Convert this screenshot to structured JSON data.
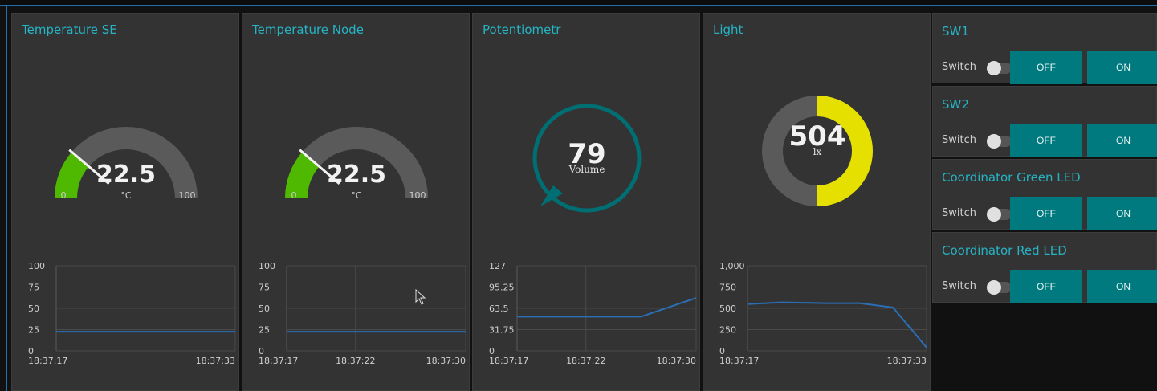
{
  "panels": [
    {
      "title": "Temperature SE",
      "gauge": {
        "value": "22.5",
        "unit": "°C",
        "min": "0",
        "max": "100",
        "fraction": 0.225,
        "fill_color": "#4fb800",
        "track_color": "#5a5a5a"
      },
      "chart_data": {
        "type": "line",
        "x": [
          "18:37:17",
          "18:37:33"
        ],
        "xticks": [
          "18:37:17",
          "18:37:33"
        ],
        "yticks": [
          "100",
          "75",
          "50",
          "25",
          "0"
        ],
        "ylim": [
          0,
          100
        ],
        "series": [
          {
            "values": [
              22.5,
              22.5
            ]
          }
        ],
        "grid": true
      }
    },
    {
      "title": "Temperature Node",
      "gauge": {
        "value": "22.5",
        "unit": "°C",
        "min": "0",
        "max": "100",
        "fraction": 0.225,
        "fill_color": "#4fb800",
        "track_color": "#5a5a5a"
      },
      "chart_data": {
        "type": "line",
        "x": [
          "18:37:17",
          "18:37:30"
        ],
        "xticks": [
          "18:37:17",
          "18:37:22",
          "18:37:30"
        ],
        "yticks": [
          "100",
          "75",
          "50",
          "25",
          "0"
        ],
        "ylim": [
          0,
          100
        ],
        "series": [
          {
            "values": [
              22.5,
              22.5
            ]
          }
        ],
        "grid": true
      }
    },
    {
      "title": "Potentiometr",
      "knob": {
        "value": "79",
        "label": "Volume",
        "color": "#006f73"
      },
      "chart_data": {
        "type": "line",
        "x": [
          "18:37:17",
          "18:37:20",
          "18:37:26",
          "18:37:30"
        ],
        "xticks": [
          "18:37:17",
          "18:37:22",
          "18:37:30"
        ],
        "yticks": [
          "127",
          "95.25",
          "63.5",
          "31.75",
          "0"
        ],
        "ylim": [
          0,
          127
        ],
        "series": [
          {
            "values": [
              51,
              51,
              51,
              79
            ]
          }
        ],
        "grid": true
      }
    },
    {
      "title": "Light",
      "donut": {
        "value": "504",
        "unit": "lx",
        "fraction": 0.5,
        "fill_color": "#e5e000",
        "track_color": "#5a5a5a"
      },
      "chart_data": {
        "type": "line",
        "x": [
          "18:37:17",
          "18:37:20",
          "18:37:24",
          "18:37:27",
          "18:37:30",
          "18:37:33"
        ],
        "xticks": [
          "18:37:17",
          "18:37:33"
        ],
        "yticks": [
          "1,000",
          "750",
          "500",
          "250",
          "0"
        ],
        "ylim": [
          0,
          1000
        ],
        "series": [
          {
            "values": [
              550,
              570,
              560,
              560,
              510,
              40
            ]
          }
        ],
        "grid": true
      }
    }
  ],
  "switch_groups": [
    {
      "title": "SW1",
      "switch_label": "Switch",
      "off_label": "OFF",
      "on_label": "ON"
    },
    {
      "title": "SW2",
      "switch_label": "Switch",
      "off_label": "OFF",
      "on_label": "ON"
    },
    {
      "title": "Coordinator Green LED",
      "switch_label": "Switch",
      "off_label": "OFF",
      "on_label": "ON"
    },
    {
      "title": "Coordinator Red LED",
      "switch_label": "Switch",
      "off_label": "OFF",
      "on_label": "ON"
    }
  ],
  "colors": {
    "accent": "#26b3c4",
    "button": "#007a7f",
    "line": "#2a6fb5",
    "panel": "#333333",
    "background": "#111111"
  }
}
